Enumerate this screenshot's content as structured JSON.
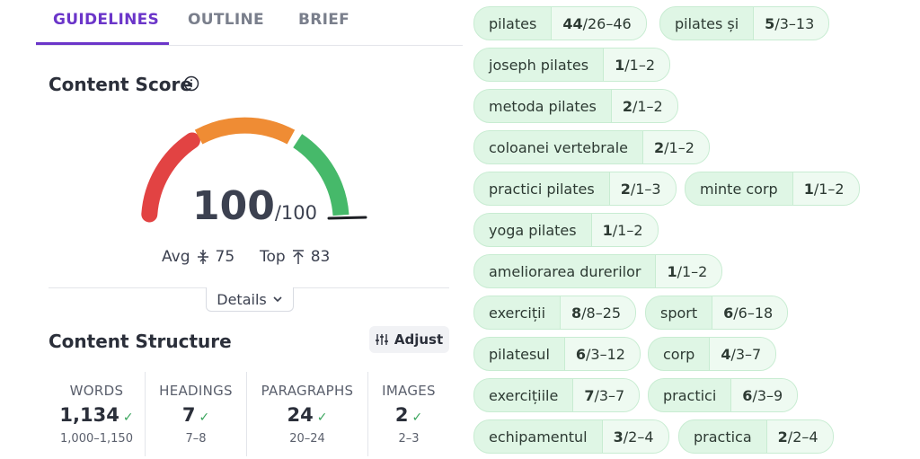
{
  "tabs": [
    {
      "label": "GUIDELINES",
      "active": true
    },
    {
      "label": "OUTLINE",
      "active": false
    },
    {
      "label": "BRIEF",
      "active": false
    }
  ],
  "content_score": {
    "title": "Content Score",
    "info_icon": "info-circle-icon",
    "score": "100",
    "max": "/100",
    "avg_label": "Avg",
    "avg_value": "75",
    "top_label": "Top",
    "top_value": "83",
    "details_label": "Details",
    "gauge_colors": {
      "low": "#e24343",
      "mid": "#ef8c34",
      "high": "#46b96a"
    }
  },
  "content_structure": {
    "title": "Content Structure",
    "adjust_label": "Adjust",
    "stats": [
      {
        "label": "WORDS",
        "value": "1,134",
        "range": "1,000–1,150"
      },
      {
        "label": "HEADINGS",
        "value": "7",
        "range": "7–8"
      },
      {
        "label": "PARAGRAPHS",
        "value": "24",
        "range": "20–24"
      },
      {
        "label": "IMAGES",
        "value": "2",
        "range": "2–3"
      }
    ]
  },
  "keywords": [
    {
      "term": "pilates",
      "used": "44",
      "range": "26–46"
    },
    {
      "term": "pilates și",
      "used": "5",
      "range": "3–13"
    },
    {
      "term": "joseph pilates",
      "used": "1",
      "range": "1–2"
    },
    {
      "term": "metoda pilates",
      "used": "2",
      "range": "1–2"
    },
    {
      "term": "coloanei vertebrale",
      "used": "2",
      "range": "1–2"
    },
    {
      "term": "practici pilates",
      "used": "2",
      "range": "1–3"
    },
    {
      "term": "minte corp",
      "used": "1",
      "range": "1–2"
    },
    {
      "term": "yoga pilates",
      "used": "1",
      "range": "1–2"
    },
    {
      "term": "ameliorarea durerilor",
      "used": "1",
      "range": "1–2"
    },
    {
      "term": "exerciții",
      "used": "8",
      "range": "8–25"
    },
    {
      "term": "sport",
      "used": "6",
      "range": "6–18"
    },
    {
      "term": "pilatesul",
      "used": "6",
      "range": "3–12"
    },
    {
      "term": "corp",
      "used": "4",
      "range": "3–7"
    },
    {
      "term": "exercițiile",
      "used": "7",
      "range": "3–7"
    },
    {
      "term": "practici",
      "used": "6",
      "range": "3–9"
    },
    {
      "term": "echipamentul",
      "used": "3",
      "range": "2–4"
    },
    {
      "term": "practica",
      "used": "2",
      "range": "2–4"
    }
  ]
}
